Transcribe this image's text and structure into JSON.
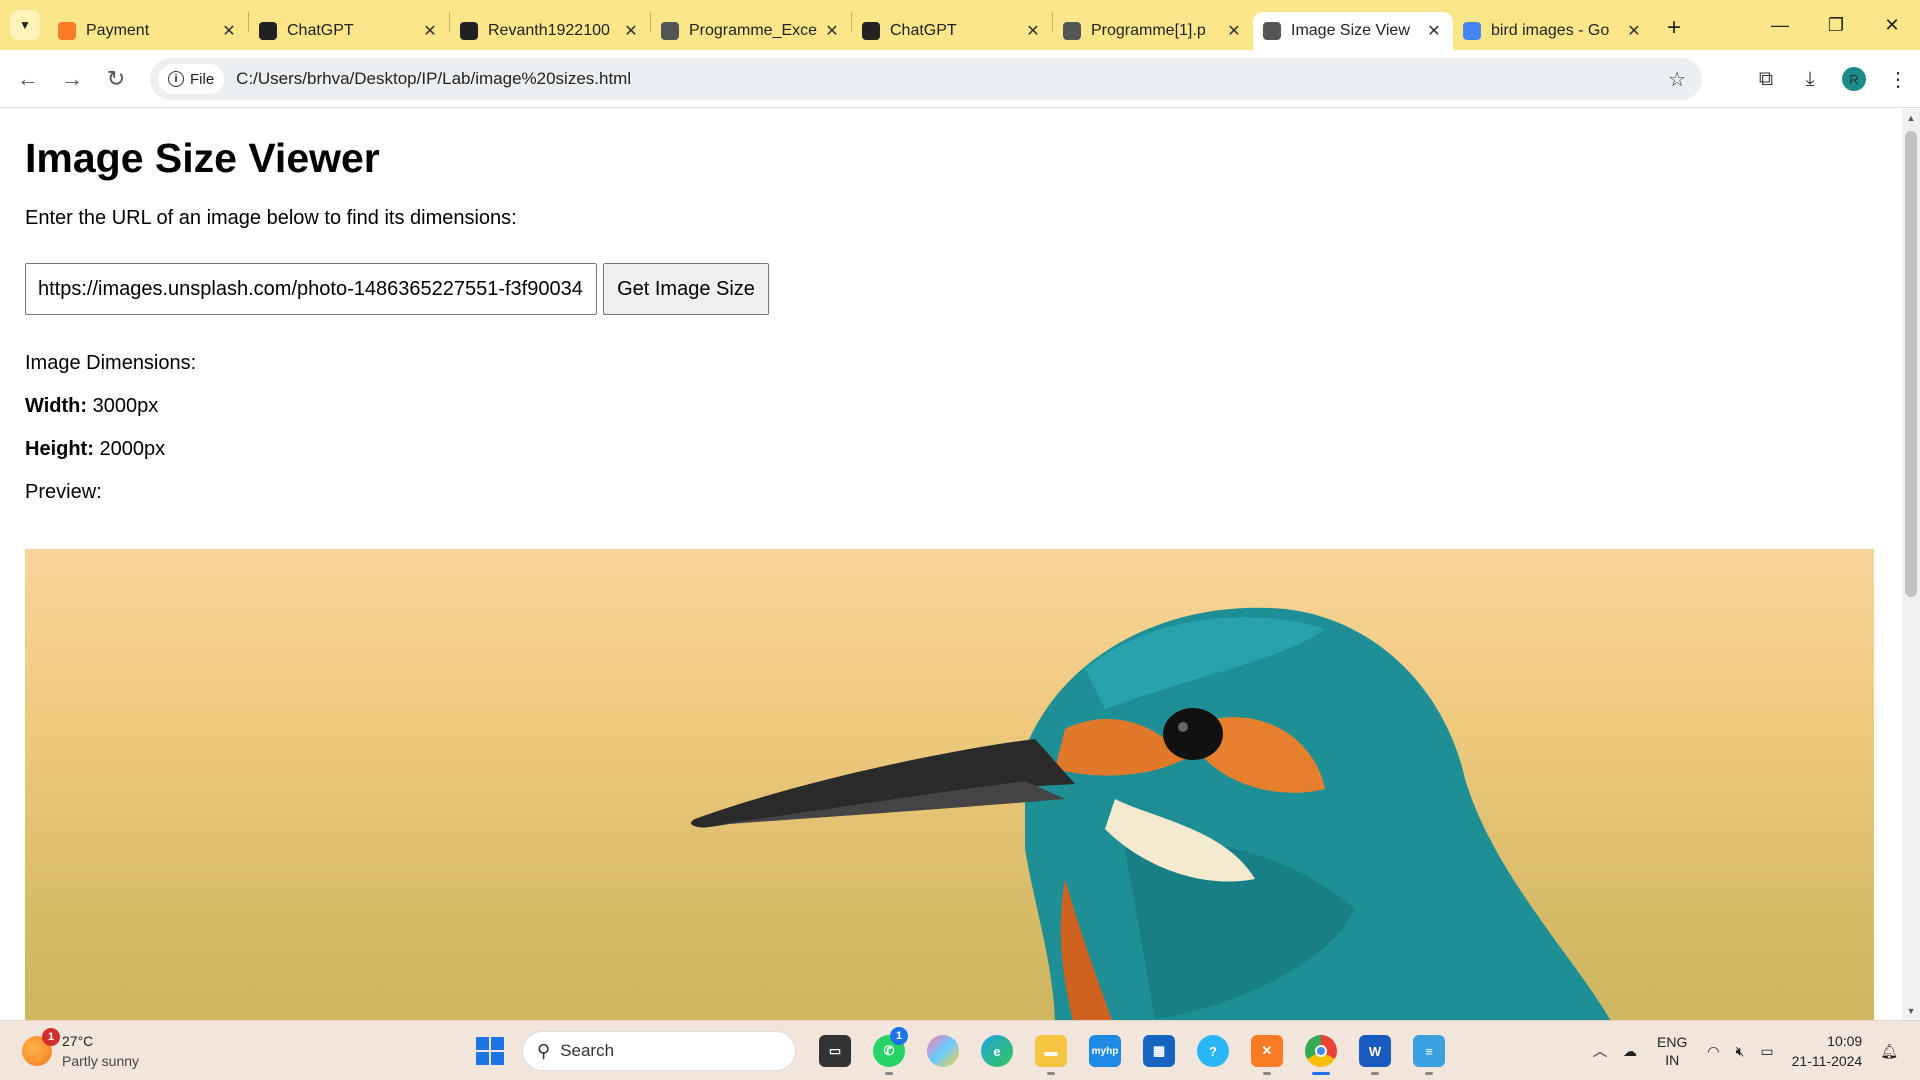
{
  "browser": {
    "tabs": [
      {
        "title": "Payment",
        "favicon": "xampp-icon",
        "color": "#fb7a24",
        "active": false
      },
      {
        "title": "ChatGPT",
        "favicon": "chatgpt-icon",
        "color": "#222222",
        "active": false
      },
      {
        "title": "Revanth1922100",
        "favicon": "github-icon",
        "color": "#222222",
        "active": false
      },
      {
        "title": "Programme_Exce",
        "favicon": "globe-icon",
        "color": "#555555",
        "active": false
      },
      {
        "title": "ChatGPT",
        "favicon": "chatgpt-icon",
        "color": "#222222",
        "active": false
      },
      {
        "title": "Programme[1].p",
        "favicon": "globe-icon",
        "color": "#555555",
        "active": false
      },
      {
        "title": "Image Size View",
        "favicon": "globe-icon",
        "color": "#555555",
        "active": true
      },
      {
        "title": "bird images - Go",
        "favicon": "google-icon",
        "color": "#4285f4",
        "active": false
      }
    ],
    "address": {
      "scheme_label": "File",
      "url": "C:/Users/brhva/Desktop/IP/Lab/image%20sizes.html"
    },
    "profile_initial": "R"
  },
  "page": {
    "heading": "Image Size Viewer",
    "intro": "Enter the URL of an image below to find its dimensions:",
    "url_input_value": "https://images.unsplash.com/photo-1486365227551-f3f90034",
    "button_label": "Get Image Size",
    "dimensions_label": "Image Dimensions:",
    "width_label": "Width:",
    "width_value": " 3000px",
    "height_label": "Height:",
    "height_value": " 2000px",
    "preview_label": "Preview:"
  },
  "taskbar": {
    "weather_temp": "27°C",
    "weather_desc": "Partly sunny",
    "weather_badge": "1",
    "search_placeholder": "Search",
    "whatsapp_badge": "1",
    "lang_top": "ENG",
    "lang_bottom": "IN",
    "time": "10:09",
    "date": "21-11-2024"
  }
}
